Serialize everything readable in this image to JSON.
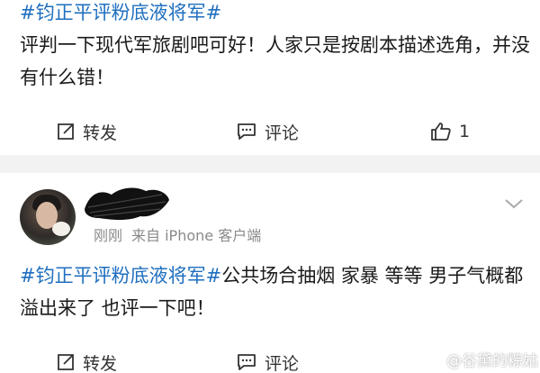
{
  "posts": [
    {
      "tag": "#钧正平评粉底液将军#",
      "text": "评判一下现代军旅剧吧可好！人家只是按剧本描述选角，并没有什么错！",
      "actions": {
        "repost": "转发",
        "comment": "评论",
        "like_count": "1"
      }
    },
    {
      "meta": {
        "time": "刚刚",
        "source": "来自 iPhone 客户端"
      },
      "tag": "#钧正平评粉底液将军#",
      "text": "公共场合抽烟 家暴 等等 男子气概都溢出来了 也评一下吧！",
      "actions": {
        "repost": "转发",
        "comment": "评论",
        "like_count": ""
      }
    }
  ],
  "watermark": {
    "text": "@谷黛的粽姑"
  },
  "colors": {
    "link": "#1f6fbf",
    "divider": "#f2f2f2",
    "meta": "#8a8a8a"
  },
  "icons": {
    "repost": "share-edit-icon",
    "comment": "comment-bubble-icon",
    "like": "thumbs-up-icon",
    "more": "chevron-down-icon",
    "watermark": "weibo-logo-icon"
  }
}
